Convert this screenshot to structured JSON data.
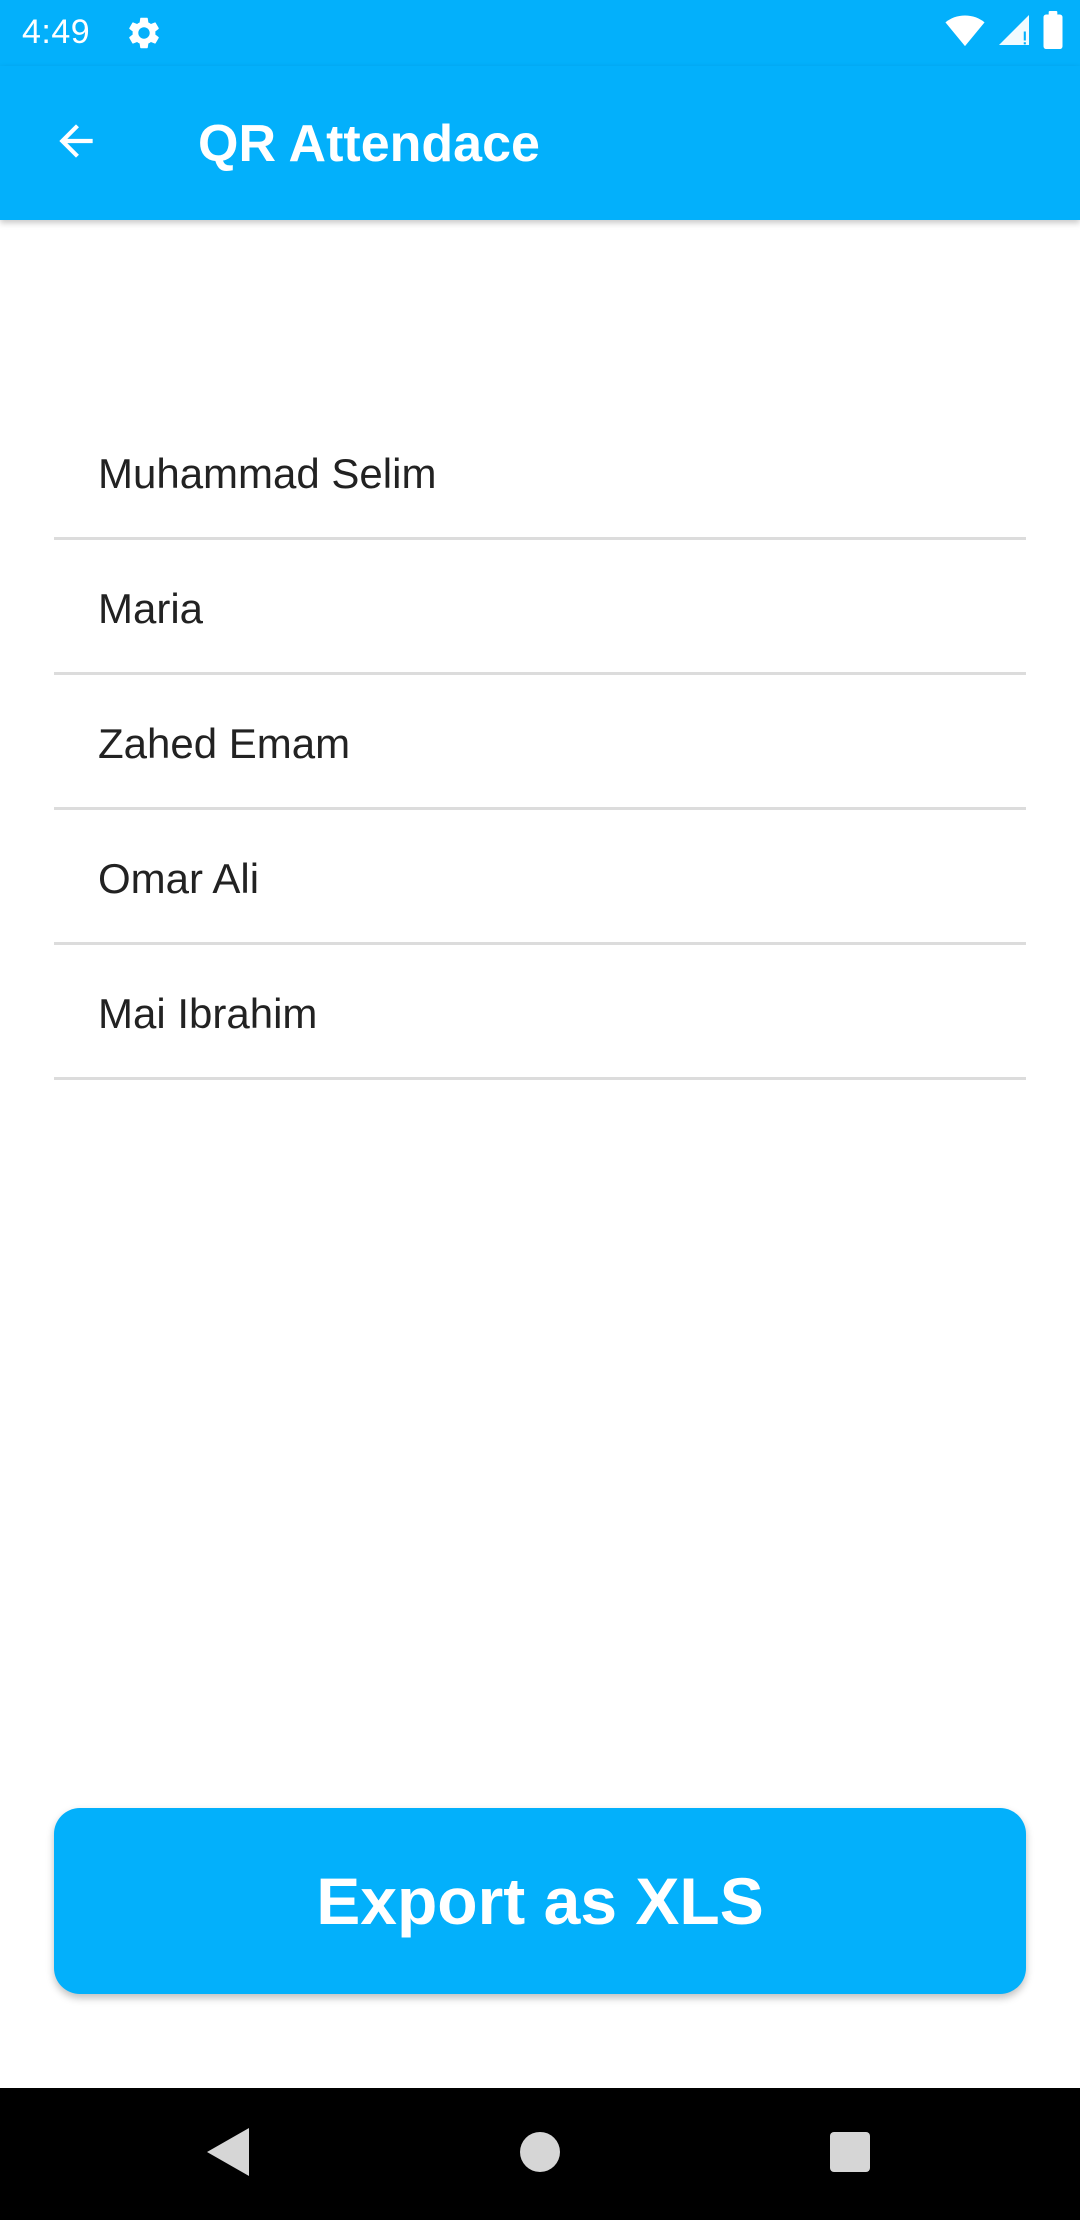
{
  "status_bar": {
    "time": "4:49",
    "icons": [
      "settings-gear-icon",
      "wifi-icon",
      "signal-icon",
      "battery-icon"
    ]
  },
  "app_bar": {
    "title": "QR Attendace",
    "back_icon": "arrow-back-icon"
  },
  "attendance": {
    "items": [
      {
        "name": "Muhammad Selim"
      },
      {
        "name": "Maria"
      },
      {
        "name": "Zahed Emam"
      },
      {
        "name": "Omar Ali"
      },
      {
        "name": "Mai Ibrahim"
      }
    ]
  },
  "actions": {
    "export_label": "Export as XLS"
  },
  "nav_bar": {
    "buttons": [
      "nav-back-icon",
      "nav-home-icon",
      "nav-recents-icon"
    ]
  },
  "colors": {
    "primary": "#03b0fb",
    "divider": "#dcdcdc",
    "text": "#222222",
    "nav_background": "#000000"
  }
}
